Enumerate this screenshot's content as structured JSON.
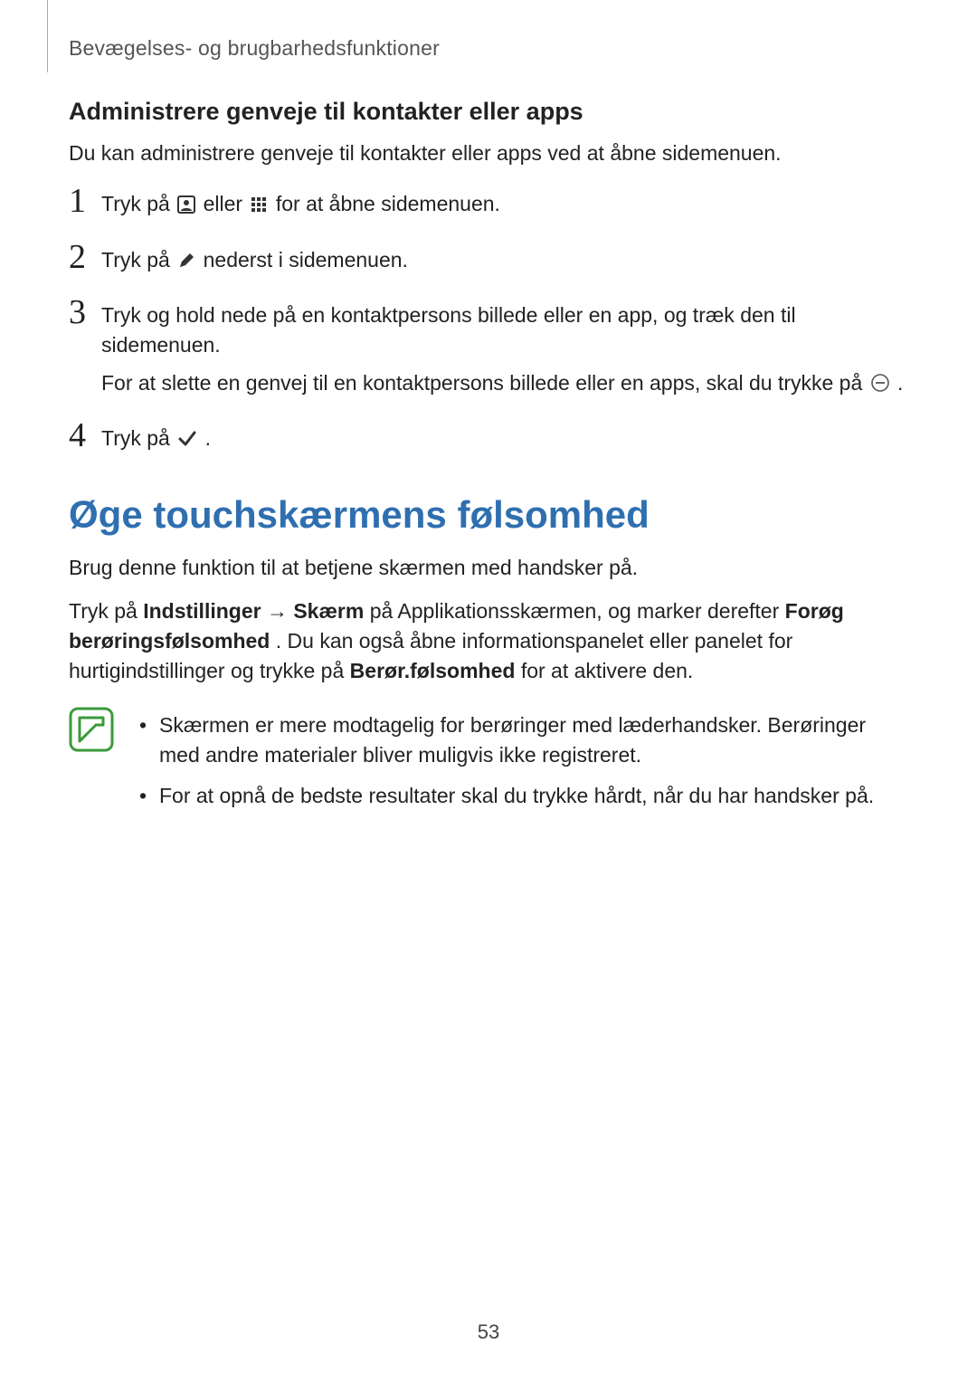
{
  "runningHead": "Bevægelses- og brugbarhedsfunktioner",
  "subheading": "Administrere genveje til kontakter eller apps",
  "intro": "Du kan administrere genveje til kontakter eller apps ved at åbne sidemenuen.",
  "steps": {
    "s1": {
      "num": "1",
      "t1": "Tryk på ",
      "t2": " eller ",
      "t3": " for at åbne sidemenuen."
    },
    "s2": {
      "num": "2",
      "t1": "Tryk på ",
      "t2": " nederst i sidemenuen."
    },
    "s3": {
      "num": "3",
      "line1": "Tryk og hold nede på en kontaktpersons billede eller en app, og træk den til sidemenuen.",
      "line2a": "For at slette en genvej til en kontaktpersons billede eller en apps, skal du trykke på ",
      "line2b": "."
    },
    "s4": {
      "num": "4",
      "t1": "Tryk på ",
      "t2": "."
    }
  },
  "sectionTitle": "Øge touchskærmens følsomhed",
  "sensitivityIntro": "Brug denne funktion til at betjene skærmen med handsker på.",
  "sensitivityPara": {
    "p1": "Tryk på ",
    "b1": "Indstillinger",
    "arrow": " → ",
    "b2": "Skærm",
    "p2": " på Applikationsskærmen, og marker derefter ",
    "b3": "Forøg berøringsfølsomhed",
    "p3": ". Du kan også åbne informationspanelet eller panelet for hurtigindstillinger og trykke på ",
    "b4": "Berør.følsomhed",
    "p4": " for at aktivere den."
  },
  "notes": {
    "n1": "Skærmen er mere modtagelig for berøringer med læderhandsker. Berøringer med andre materialer bliver muligvis ikke registreret.",
    "n2": "For at opnå de bedste resultater skal du trykke hårdt, når du har handsker på."
  },
  "pageNumber": "53"
}
